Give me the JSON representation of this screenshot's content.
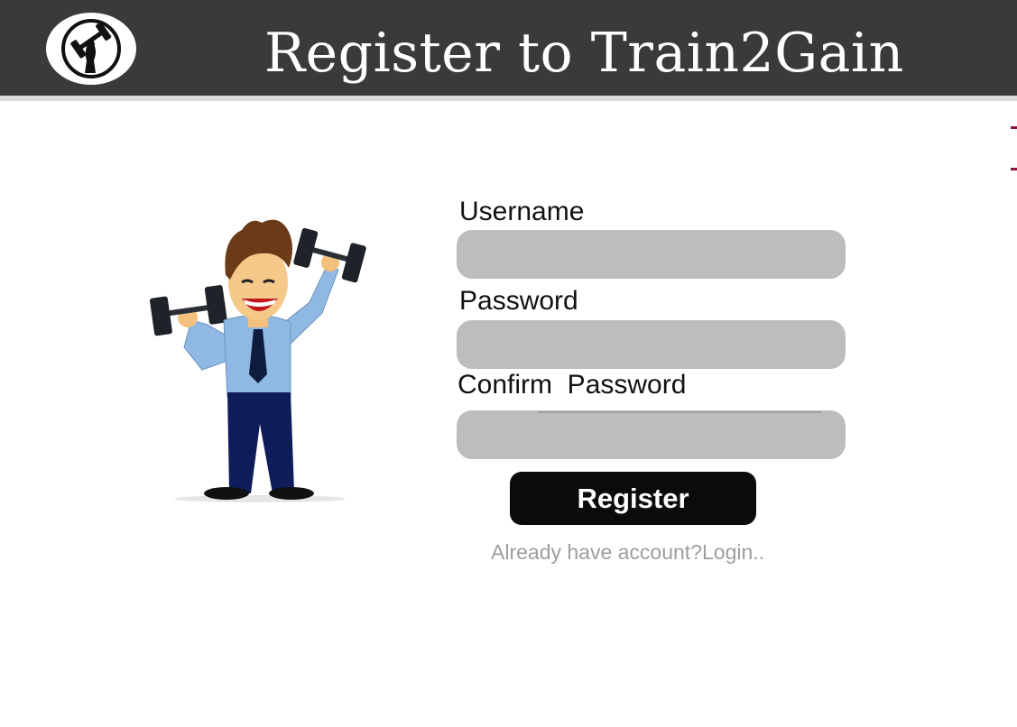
{
  "header": {
    "title": "Register to Train2Gain",
    "logo_icon": "muscle-arm-dumbbell-icon",
    "background": "#3a3a3a"
  },
  "illustration": {
    "icon": "man-lifting-dumbbells-illustration"
  },
  "form": {
    "username": {
      "label": "Username",
      "value": "",
      "placeholder": ""
    },
    "password": {
      "label": "Password",
      "value": "",
      "placeholder": ""
    },
    "confirm_password": {
      "label": "Confirm  Password",
      "value": "",
      "placeholder": ""
    },
    "register_label": "Register",
    "login_link": "Already have account?Login.."
  },
  "colors": {
    "input_bg": "#bdbdbd",
    "button_bg": "#0b0b0b",
    "link_text": "#9e9e9e",
    "edge_accent": "#8a1538"
  }
}
